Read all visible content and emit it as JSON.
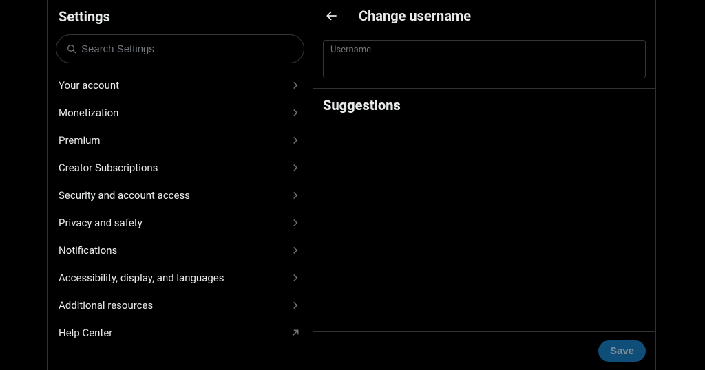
{
  "settings": {
    "title": "Settings",
    "search_placeholder": "Search Settings",
    "items": [
      {
        "label": "Your account",
        "icon": "chevron"
      },
      {
        "label": "Monetization",
        "icon": "chevron"
      },
      {
        "label": "Premium",
        "icon": "chevron"
      },
      {
        "label": "Creator Subscriptions",
        "icon": "chevron"
      },
      {
        "label": "Security and account access",
        "icon": "chevron"
      },
      {
        "label": "Privacy and safety",
        "icon": "chevron"
      },
      {
        "label": "Notifications",
        "icon": "chevron"
      },
      {
        "label": "Accessibility, display, and languages",
        "icon": "chevron"
      },
      {
        "label": "Additional resources",
        "icon": "chevron"
      },
      {
        "label": "Help Center",
        "icon": "external"
      }
    ]
  },
  "detail": {
    "title": "Change username",
    "username_label": "Username",
    "username_value": "",
    "suggestions_heading": "Suggestions",
    "save_label": "Save"
  }
}
